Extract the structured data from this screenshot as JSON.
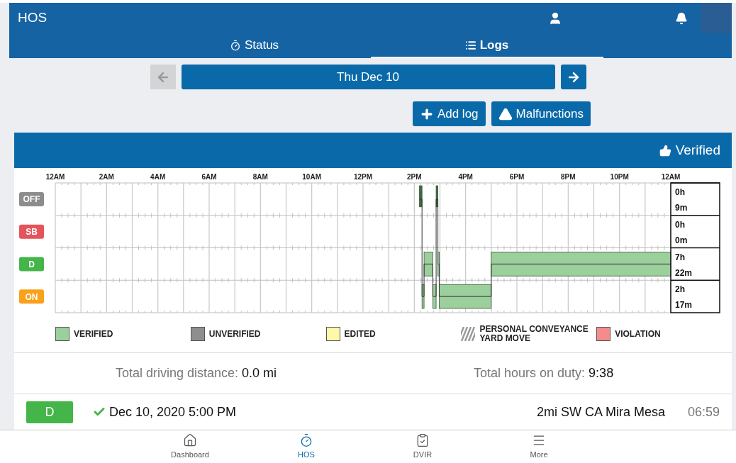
{
  "app_bar": {
    "title": "HOS"
  },
  "tabs": [
    {
      "label": "Status",
      "selected": false
    },
    {
      "label": "Logs",
      "selected": true
    }
  ],
  "date_nav": {
    "date": "Thu Dec 10",
    "prev_disabled": true,
    "next_disabled": false
  },
  "actions": [
    "Add log",
    "Malfunctions"
  ],
  "card": {
    "status": "Verified"
  },
  "statuses": [
    {
      "label": "OFF",
      "color": "#8c8c8c",
      "hours": "0h",
      "minutes": "9m"
    },
    {
      "label": "SB",
      "color": "#e5535b",
      "hours": "0h",
      "minutes": "0m"
    },
    {
      "label": "D",
      "color": "#44b549",
      "hours": "7h",
      "minutes": "22m"
    },
    {
      "label": "ON",
      "color": "#f9a11b",
      "hours": "2h",
      "minutes": "17m"
    }
  ],
  "hour_labels": [
    "12AM",
    "2AM",
    "4AM",
    "6AM",
    "8AM",
    "10AM",
    "12PM",
    "2PM",
    "4PM",
    "6PM",
    "8PM",
    "10PM",
    "12AM"
  ],
  "legend": [
    {
      "label": "VERIFIED",
      "kind": "swatch",
      "color": "#9bcf9b"
    },
    {
      "label": "UNVERIFIED",
      "kind": "swatch",
      "color": "#8e8e8e"
    },
    {
      "label": "EDITED",
      "kind": "swatch",
      "color": "#fdf9a8"
    },
    {
      "label": "PERSONAL CONVEYANCE",
      "label_2": "YARD MOVE",
      "kind": "hatch",
      "color": "#9a9a9a"
    },
    {
      "label": "VIOLATION",
      "kind": "swatch",
      "color": "#f58c8c"
    }
  ],
  "totals": [
    {
      "label": "Total driving distance:",
      "value": "0.0 mi"
    },
    {
      "label": "Total hours on duty:",
      "value": "9:38"
    }
  ],
  "entries": [
    {
      "status": "D",
      "color": "#44b549",
      "verified": true,
      "time": "Dec 10, 2020 5:00 PM",
      "location": "2mi SW CA Mira Mesa",
      "duration": "06:59"
    }
  ],
  "bottom_nav": [
    {
      "label": "Dashboard",
      "selected": false
    },
    {
      "label": "HOS",
      "selected": true
    },
    {
      "label": "DVIR",
      "selected": false
    },
    {
      "label": "More",
      "selected": false
    }
  ]
}
